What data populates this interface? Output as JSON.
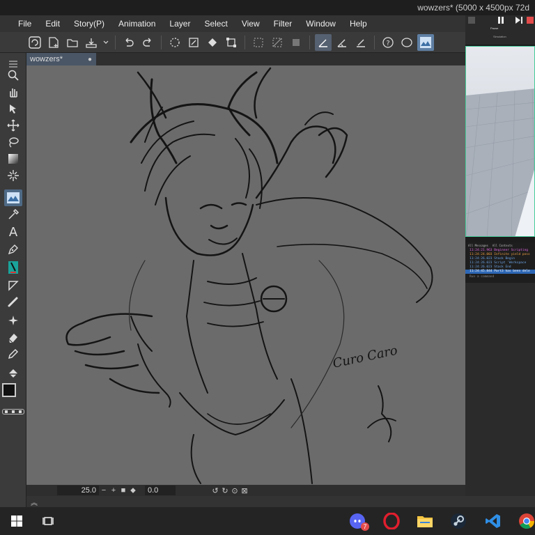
{
  "window": {
    "title": "wowzers* (5000 x 4500px 72d"
  },
  "menu": [
    "File",
    "Edit",
    "Story(P)",
    "Animation",
    "Layer",
    "Select",
    "View",
    "Filter",
    "Window",
    "Help"
  ],
  "document": {
    "tab_label": "wowzers*",
    "tab_close": "●"
  },
  "canvas": {
    "signature": "Curo Caro"
  },
  "status": {
    "zoom": "25.0",
    "rotation": "0.0"
  },
  "colors": {
    "accent": "#4e6a86",
    "canvas_bg": "#6b6b6b",
    "main_color": "#111111",
    "sub_color": "#ffffff"
  },
  "roblox": {
    "ribbon": [
      "Pause",
      "Simulation"
    ],
    "output_tabs": [
      "All Messages",
      "All Contexts"
    ],
    "output": [
      "11:24:21.963  Beginner Scripting",
      "11:24:24.003  Infinite yield poss",
      "11:24:26.023  Stack Begin",
      "11:24:26.023  Script 'Workspace",
      "11:24:26.023  Stack End",
      "11:24:45.844  Part3 has been dele"
    ],
    "command_placeholder": "Run a command"
  },
  "taskbar": {
    "badge_count": "7",
    "apps": [
      "start-icon",
      "task-view-icon",
      "discord-icon",
      "opera-icon",
      "file-explorer-icon",
      "steam-icon",
      "vscode-icon",
      "chrome-icon"
    ]
  }
}
